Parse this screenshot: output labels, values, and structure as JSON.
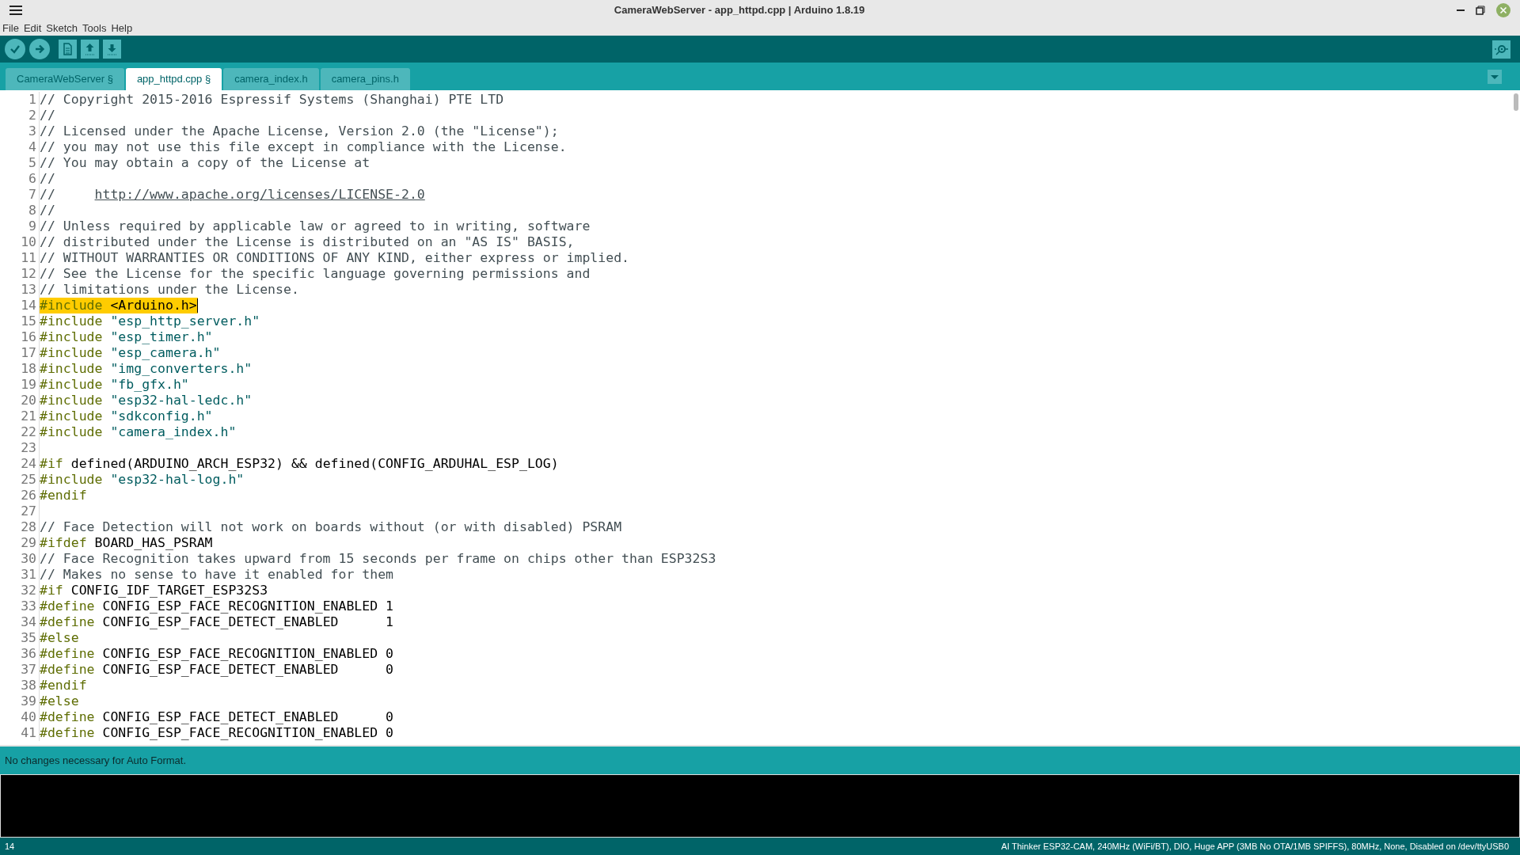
{
  "window": {
    "title": "CameraWebServer - app_httpd.cpp | Arduino 1.8.19"
  },
  "menu": [
    "File",
    "Edit",
    "Sketch",
    "Tools",
    "Help"
  ],
  "tabs": [
    {
      "label": "CameraWebServer §",
      "selected": false
    },
    {
      "label": "app_httpd.cpp §",
      "selected": true
    },
    {
      "label": "camera_index.h",
      "selected": false
    },
    {
      "label": "camera_pins.h",
      "selected": false
    }
  ],
  "code_lines": [
    {
      "number": "1",
      "highlighted": false,
      "segments": [
        {
          "kind": "comment",
          "text": "// Copyright 2015-2016 Espressif Systems (Shanghai) PTE LTD"
        }
      ]
    },
    {
      "number": "2",
      "highlighted": false,
      "segments": [
        {
          "kind": "comment",
          "text": "//"
        }
      ]
    },
    {
      "number": "3",
      "highlighted": false,
      "segments": [
        {
          "kind": "comment",
          "text": "// Licensed under the Apache License, Version 2.0 (the \"License\");"
        }
      ]
    },
    {
      "number": "4",
      "highlighted": false,
      "segments": [
        {
          "kind": "comment",
          "text": "// you may not use this file except in compliance with the License."
        }
      ]
    },
    {
      "number": "5",
      "highlighted": false,
      "segments": [
        {
          "kind": "comment",
          "text": "// You may obtain a copy of the License at"
        }
      ]
    },
    {
      "number": "6",
      "highlighted": false,
      "segments": [
        {
          "kind": "comment",
          "text": "//"
        }
      ]
    },
    {
      "number": "7",
      "highlighted": false,
      "segments": [
        {
          "kind": "comment",
          "text": "//     "
        },
        {
          "kind": "url",
          "text": "http://www.apache.org/licenses/LICENSE-2.0"
        }
      ]
    },
    {
      "number": "8",
      "highlighted": false,
      "segments": [
        {
          "kind": "comment",
          "text": "//"
        }
      ]
    },
    {
      "number": "9",
      "highlighted": false,
      "segments": [
        {
          "kind": "comment",
          "text": "// Unless required by applicable law or agreed to in writing, software"
        }
      ]
    },
    {
      "number": "10",
      "highlighted": false,
      "segments": [
        {
          "kind": "comment",
          "text": "// distributed under the License is distributed on an \"AS IS\" BASIS,"
        }
      ]
    },
    {
      "number": "11",
      "highlighted": false,
      "segments": [
        {
          "kind": "comment",
          "text": "// WITHOUT WARRANTIES OR CONDITIONS OF ANY KIND, either express or implied."
        }
      ]
    },
    {
      "number": "12",
      "highlighted": false,
      "segments": [
        {
          "kind": "comment",
          "text": "// See the License for the specific language governing permissions and"
        }
      ]
    },
    {
      "number": "13",
      "highlighted": false,
      "segments": [
        {
          "kind": "comment",
          "text": "// limitations under the License."
        }
      ]
    },
    {
      "number": "14",
      "highlighted": true,
      "segments": [
        {
          "kind": "directive",
          "text": "#include"
        },
        {
          "kind": "plain",
          "text": " <Arduino.h>"
        }
      ]
    },
    {
      "number": "15",
      "highlighted": false,
      "segments": [
        {
          "kind": "directive",
          "text": "#include"
        },
        {
          "kind": "string",
          "text": " \"esp_http_server.h\""
        }
      ]
    },
    {
      "number": "16",
      "highlighted": false,
      "segments": [
        {
          "kind": "directive",
          "text": "#include"
        },
        {
          "kind": "string",
          "text": " \"esp_timer.h\""
        }
      ]
    },
    {
      "number": "17",
      "highlighted": false,
      "segments": [
        {
          "kind": "directive",
          "text": "#include"
        },
        {
          "kind": "string",
          "text": " \"esp_camera.h\""
        }
      ]
    },
    {
      "number": "18",
      "highlighted": false,
      "segments": [
        {
          "kind": "directive",
          "text": "#include"
        },
        {
          "kind": "string",
          "text": " \"img_converters.h\""
        }
      ]
    },
    {
      "number": "19",
      "highlighted": false,
      "segments": [
        {
          "kind": "directive",
          "text": "#include"
        },
        {
          "kind": "string",
          "text": " \"fb_gfx.h\""
        }
      ]
    },
    {
      "number": "20",
      "highlighted": false,
      "segments": [
        {
          "kind": "directive",
          "text": "#include"
        },
        {
          "kind": "string",
          "text": " \"esp32-hal-ledc.h\""
        }
      ]
    },
    {
      "number": "21",
      "highlighted": false,
      "segments": [
        {
          "kind": "directive",
          "text": "#include"
        },
        {
          "kind": "string",
          "text": " \"sdkconfig.h\""
        }
      ]
    },
    {
      "number": "22",
      "highlighted": false,
      "segments": [
        {
          "kind": "directive",
          "text": "#include"
        },
        {
          "kind": "string",
          "text": " \"camera_index.h\""
        }
      ]
    },
    {
      "number": "23",
      "highlighted": false
    },
    {
      "number": "24",
      "highlighted": false,
      "segments": [
        {
          "kind": "directive",
          "text": "#if"
        },
        {
          "kind": "plain",
          "text": " defined(ARDUINO_ARCH_ESP32) && defined(CONFIG_ARDUHAL_ESP_LOG)"
        }
      ]
    },
    {
      "number": "25",
      "highlighted": false,
      "segments": [
        {
          "kind": "directive",
          "text": "#include"
        },
        {
          "kind": "string",
          "text": " \"esp32-hal-log.h\""
        }
      ]
    },
    {
      "number": "26",
      "highlighted": false,
      "segments": [
        {
          "kind": "directive",
          "text": "#endif"
        }
      ]
    },
    {
      "number": "27",
      "highlighted": false
    },
    {
      "number": "28",
      "highlighted": false,
      "segments": [
        {
          "kind": "comment",
          "text": "// Face Detection will not work on boards without (or with disabled) PSRAM"
        }
      ]
    },
    {
      "number": "29",
      "highlighted": false,
      "segments": [
        {
          "kind": "directive",
          "text": "#ifdef"
        },
        {
          "kind": "plain",
          "text": " BOARD_HAS_PSRAM"
        }
      ]
    },
    {
      "number": "30",
      "highlighted": false,
      "segments": [
        {
          "kind": "comment",
          "text": "// Face Recognition takes upward from 15 seconds per frame on chips other than ESP32S3"
        }
      ]
    },
    {
      "number": "31",
      "highlighted": false,
      "segments": [
        {
          "kind": "comment",
          "text": "// Makes no sense to have it enabled for them"
        }
      ]
    },
    {
      "number": "32",
      "highlighted": false,
      "segments": [
        {
          "kind": "directive",
          "text": "#if"
        },
        {
          "kind": "plain",
          "text": " CONFIG_IDF_TARGET_ESP32S3"
        }
      ]
    },
    {
      "number": "33",
      "highlighted": false,
      "segments": [
        {
          "kind": "directive",
          "text": "#define"
        },
        {
          "kind": "plain",
          "text": " CONFIG_ESP_FACE_RECOGNITION_ENABLED 1"
        }
      ]
    },
    {
      "number": "34",
      "highlighted": false,
      "segments": [
        {
          "kind": "directive",
          "text": "#define"
        },
        {
          "kind": "plain",
          "text": " CONFIG_ESP_FACE_DETECT_ENABLED      1"
        }
      ]
    },
    {
      "number": "35",
      "highlighted": false,
      "segments": [
        {
          "kind": "directive",
          "text": "#else"
        }
      ]
    },
    {
      "number": "36",
      "highlighted": false,
      "segments": [
        {
          "kind": "directive",
          "text": "#define"
        },
        {
          "kind": "plain",
          "text": " CONFIG_ESP_FACE_RECOGNITION_ENABLED 0"
        }
      ]
    },
    {
      "number": "37",
      "highlighted": false,
      "segments": [
        {
          "kind": "directive",
          "text": "#define"
        },
        {
          "kind": "plain",
          "text": " CONFIG_ESP_FACE_DETECT_ENABLED      0"
        }
      ]
    },
    {
      "number": "38",
      "highlighted": false,
      "segments": [
        {
          "kind": "directive",
          "text": "#endif"
        }
      ]
    },
    {
      "number": "39",
      "highlighted": false,
      "segments": [
        {
          "kind": "directive",
          "text": "#else"
        }
      ]
    },
    {
      "number": "40",
      "highlighted": false,
      "segments": [
        {
          "kind": "directive",
          "text": "#define"
        },
        {
          "kind": "plain",
          "text": " CONFIG_ESP_FACE_DETECT_ENABLED      0"
        }
      ]
    },
    {
      "number": "41",
      "highlighted": false,
      "segments": [
        {
          "kind": "directive",
          "text": "#define"
        },
        {
          "kind": "plain",
          "text": " CONFIG_ESP_FACE_RECOGNITION_ENABLED 0"
        }
      ]
    }
  ],
  "message": "No changes necessary for Auto Format.",
  "status_bar": {
    "line": "14",
    "board": "AI Thinker ESP32-CAM, 240MHz (WiFi/BT), DIO, Huge APP (3MB No OTA/1MB SPIFFS), 80MHz, None, Disabled on /dev/ttyUSB0"
  }
}
